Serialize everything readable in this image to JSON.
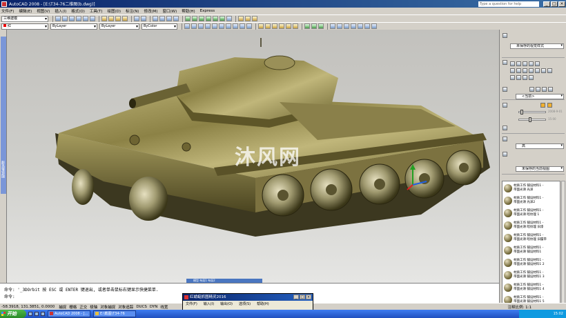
{
  "window": {
    "title": "AutoCAD 2008 - [E:\\T34-76二维图(b.dwg)]",
    "help_placeholder": "Type a question for help",
    "min": "_",
    "max": "□",
    "close": "×"
  },
  "menu": [
    "文件(F)",
    "编辑(E)",
    "视图(V)",
    "插入(I)",
    "格式(O)",
    "工具(T)",
    "绘图(D)",
    "标注(N)",
    "修改(M)",
    "窗口(W)",
    "帮助(H)",
    "Express"
  ],
  "toolbar": {
    "workspace": "三维建模",
    "color": "红",
    "linetype": "ByLayer",
    "lineweight": "ByLayer",
    "plotstyle": "ByColor"
  },
  "left_panel": {
    "label": "图纸集管理"
  },
  "right_panel": {
    "visual_style": "未保存的视觉样式",
    "material_combo": "<当前>",
    "light_combo": "高",
    "view_combo": "未保存的当前视图",
    "brightness_label": "2008-9-01",
    "contrast_label": "15:00",
    "materials": [
      {
        "line1": "材质工作  铺设材料1 -",
        "line2": "带面光滑 光泽"
      },
      {
        "line1": "材质工作  铺设材料1 -",
        "line2": "带面光滑 光泽2"
      },
      {
        "line1": "材质工作  铺设材料1 -",
        "line2": "带面光滑 暗纹理 1"
      },
      {
        "line1": "材质工作  铺设材料1 -",
        "line2": "带面光滑 暗纹理 旧漆"
      },
      {
        "line1": "材质工作  铺设材料1 -",
        "line2": "带面光滑 暗纹理 旧履带"
      },
      {
        "line1": "材质工作  铺设材料1 -",
        "line2": "带面光滑 铺设材料1"
      },
      {
        "line1": "材质工作  铺设材料1 -",
        "line2": "带面光滑 铺设材料1 2"
      },
      {
        "line1": "材质工作  铺设材料1 -",
        "line2": "带面光滑 铺设材料1 3"
      },
      {
        "line1": "材质工作  铺设材料1 -",
        "line2": "带面光滑 铺设材料1 4"
      },
      {
        "line1": "材质工作  铺设材料1 -",
        "line2": "带面光滑 铺设材料1 5"
      }
    ]
  },
  "viewport": {
    "watermark": "沐风网"
  },
  "command": {
    "line1": "命令: '_3DOrbit 按 ESC 或 ENTER 键退出, 或者单击鼠标右键显示快捷菜单.",
    "line2": "命令:"
  },
  "layout_strip": "模型 布局1 布局2",
  "status": {
    "coords": "-58.3918, 131.3851, 0.0000",
    "buttons": [
      "捕捉",
      "栅格",
      "正交",
      "极轴",
      "对象捕捉",
      "对象追踪",
      "DUCS",
      "DYN",
      "线宽"
    ],
    "right": "注释比例: 1:1"
  },
  "taskbar": {
    "start": "开始",
    "items": [
      "AutoCAD 2008 - [...",
      "E:\\截图\\T34-76"
    ],
    "clock": "15:02"
  },
  "popup": {
    "title": "红蜻蜓抓图精灵2016",
    "menu": [
      "文件(F)",
      "输入(I)",
      "输出(O)",
      "选项(S)",
      "帮助(H)"
    ],
    "min": "_",
    "max": "□",
    "close": "×"
  }
}
